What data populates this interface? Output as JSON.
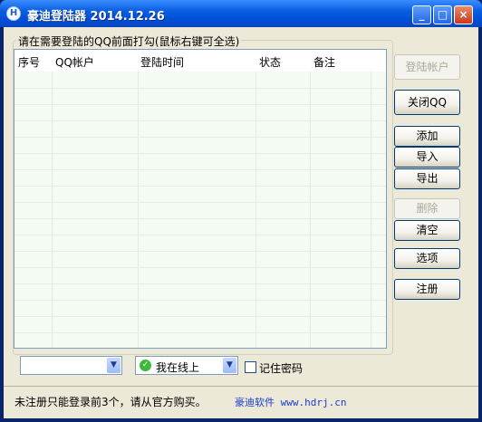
{
  "window": {
    "title": "豪迪登陆器 2014.12.26",
    "min": "_",
    "max": "□",
    "close": "×"
  },
  "group": {
    "legend": "请在需要登陆的QQ前面打勾(鼠标右键可全选)"
  },
  "table": {
    "columns": [
      "序号",
      "QQ帐户",
      "登陆时间",
      "状态",
      "备注"
    ],
    "rows": []
  },
  "buttons": {
    "login": "登陆帐户",
    "close_qq": "关闭QQ",
    "add": "添加",
    "import": "导入",
    "export": "导出",
    "delete": "删除",
    "clear": "清空",
    "options": "选项",
    "register": "注册"
  },
  "bottom": {
    "status_select": "我在线上",
    "remember_password": "记住密码",
    "account_select": ""
  },
  "footer": {
    "notice": "未注册只能登录前3个，请从官方购买。",
    "brand": "豪迪软件 www.hdrj.cn"
  },
  "colors": {
    "titlebar": "#0a5fe0",
    "face": "#ece9d8",
    "list_bg": "#f4fbf2",
    "link": "#1a3ccc"
  }
}
